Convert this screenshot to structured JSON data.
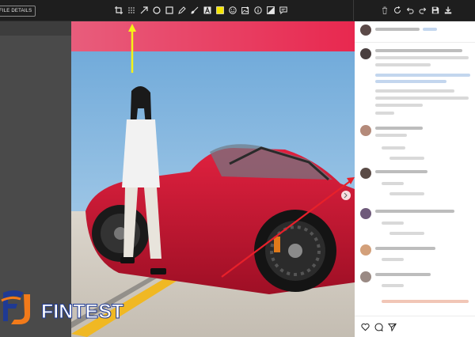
{
  "toolbar": {
    "details_label": "FILE DETAILS",
    "tools": [
      "crop-icon",
      "blur-icon",
      "arrow-icon",
      "circle-icon",
      "rectangle-icon",
      "pencil-icon",
      "brush-icon",
      "text-icon",
      "highlight-icon",
      "emoji-icon",
      "add-image-icon",
      "info-icon",
      "contrast-icon",
      "comment-icon"
    ],
    "actions": [
      "delete-icon",
      "rotate-icon",
      "undo-icon",
      "redo-icon",
      "save-icon",
      "download-icon"
    ]
  },
  "logo": {
    "text": "FINTEST"
  },
  "colors": {
    "toolbar_bg": "#1e1e1e",
    "annotation_yellow": "#f5f316",
    "annotation_red": "#e8202a",
    "car_red": "#c8142f",
    "logo_blue": "#1f3a93",
    "logo_orange": "#f27a1a"
  }
}
